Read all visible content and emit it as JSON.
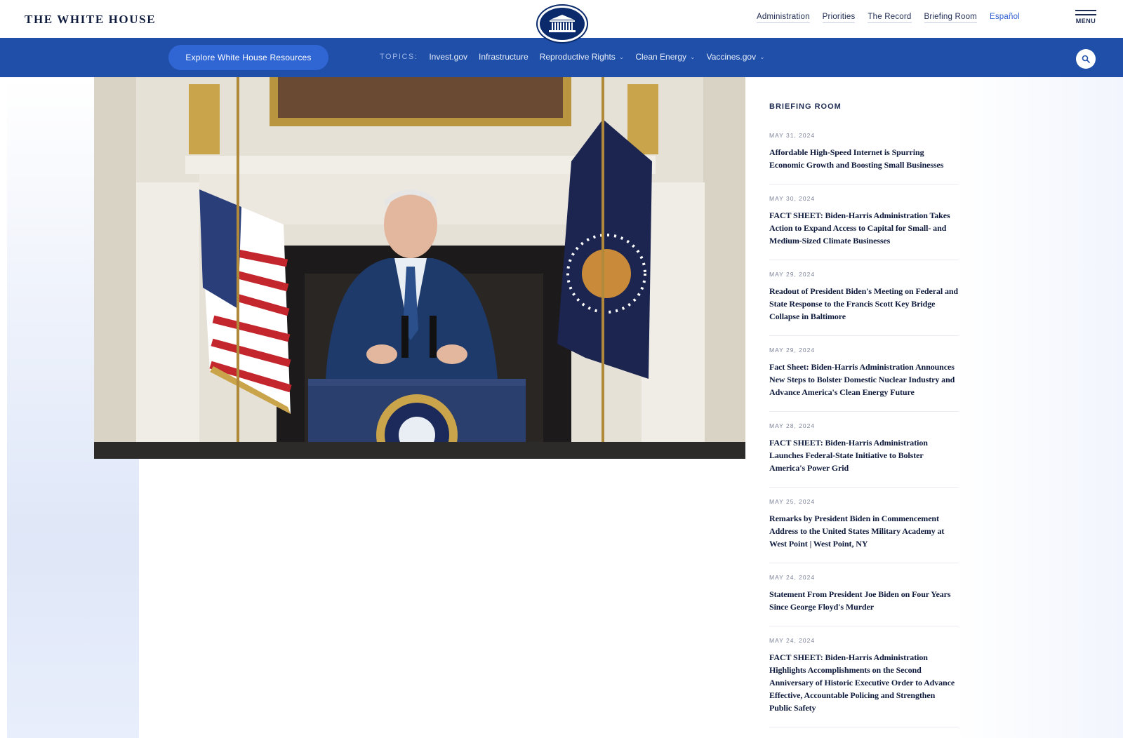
{
  "brand": {
    "wordmark": "THE WHITE HOUSE"
  },
  "top_nav": {
    "items": [
      "Administration",
      "Priorities",
      "The Record",
      "Briefing Room",
      "Español"
    ],
    "menu_label": "MENU"
  },
  "topics_bar": {
    "explore_button": "Explore White House Resources",
    "topics_label": "TOPICS:",
    "topics": [
      {
        "label": "Invest.gov",
        "has_dropdown": false
      },
      {
        "label": "Infrastructure",
        "has_dropdown": false
      },
      {
        "label": "Reproductive Rights",
        "has_dropdown": true
      },
      {
        "label": "Clean Energy",
        "has_dropdown": true
      },
      {
        "label": "Vaccines.gov",
        "has_dropdown": true
      }
    ]
  },
  "briefing_room": {
    "title": "BRIEFING ROOM",
    "items": [
      {
        "date": "MAY 31, 2024",
        "headline": "Affordable High-Speed Internet is Spurring Economic Growth and Boosting Small Businesses"
      },
      {
        "date": "MAY 30, 2024",
        "headline": "FACT SHEET: Biden-Harris Administration Takes Action to Expand Access to Capital for Small- and Medium-Sized Climate Businesses"
      },
      {
        "date": "MAY 29, 2024",
        "headline": "Readout of President Biden's Meeting on Federal and State Response to the Francis Scott Key Bridge Collapse in Baltimore"
      },
      {
        "date": "MAY 29, 2024",
        "headline": "Fact Sheet: Biden-Harris Administration Announces New Steps to Bolster Domestic Nuclear Industry and Advance America's Clean Energy Future"
      },
      {
        "date": "MAY 28, 2024",
        "headline": "FACT SHEET: Biden-Harris Administration Launches Federal-State Initiative to Bolster America's Power Grid"
      },
      {
        "date": "MAY 25, 2024",
        "headline": "Remarks by President Biden in Commencement Address to the United States Military Academy at West Point | West Point, NY"
      },
      {
        "date": "MAY 24, 2024",
        "headline": "Statement From President Joe Biden on Four Years Since George Floyd's Murder"
      },
      {
        "date": "MAY 24, 2024",
        "headline": "FACT SHEET: Biden-Harris Administration Highlights Accomplishments on the Second Anniversary of Historic Executive Order to Advance Effective, Accountable Policing and Strengthen Public Safety"
      }
    ]
  },
  "colors": {
    "brand_blue": "#1f4fa8",
    "button_blue": "#3066d4",
    "navy": "#0f1b3d",
    "espanol_link": "#2f5fd0"
  },
  "icons": [
    "white-house-seal-icon",
    "menu-icon",
    "search-icon",
    "chevron-down-icon"
  ]
}
